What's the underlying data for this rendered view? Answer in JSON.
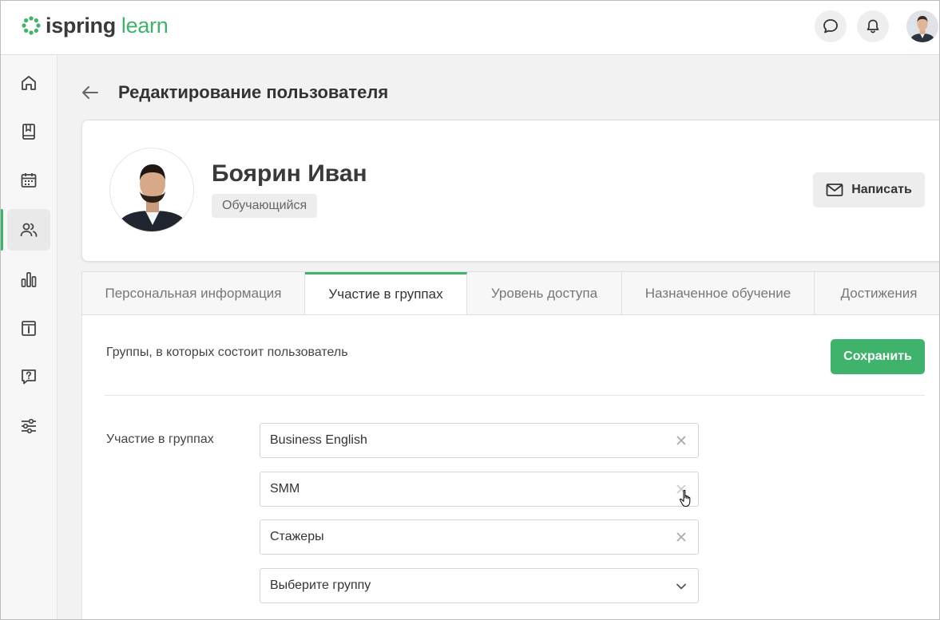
{
  "header": {
    "logo_text_bold": "ispring",
    "logo_text_light": "learn",
    "brand_color": "#3fb26c",
    "chat_icon": "chat-bubble-icon",
    "bell_icon": "bell-icon"
  },
  "sidebar": {
    "items": [
      {
        "name": "home",
        "icon": "home-icon",
        "active": false
      },
      {
        "name": "catalog",
        "icon": "book-icon",
        "active": false
      },
      {
        "name": "calendar",
        "icon": "calendar-icon",
        "active": false
      },
      {
        "name": "users",
        "icon": "users-icon",
        "active": true
      },
      {
        "name": "reports",
        "icon": "chart-icon",
        "active": false
      },
      {
        "name": "info",
        "icon": "info-icon",
        "active": false
      },
      {
        "name": "help",
        "icon": "question-icon",
        "active": false
      },
      {
        "name": "settings",
        "icon": "sliders-icon",
        "active": false
      }
    ]
  },
  "page": {
    "title": "Редактирование пользователя"
  },
  "profile": {
    "name": "Боярин Иван",
    "role": "Обучающийся",
    "write_label": "Написать"
  },
  "tabs": [
    {
      "label": "Персональная информация",
      "active": false
    },
    {
      "label": "Участие в группах",
      "active": true
    },
    {
      "label": "Уровень доступа",
      "active": false
    },
    {
      "label": "Назначенное обучение",
      "active": false
    },
    {
      "label": "Достижения",
      "active": false
    }
  ],
  "groups_section": {
    "title": "Группы, в которых состоит пользователь",
    "save_label": "Сохранить",
    "field_label": "Участие в группах",
    "groups": [
      "Business English",
      "SMM",
      "Стажеры"
    ],
    "select_placeholder": "Выберите группу"
  }
}
